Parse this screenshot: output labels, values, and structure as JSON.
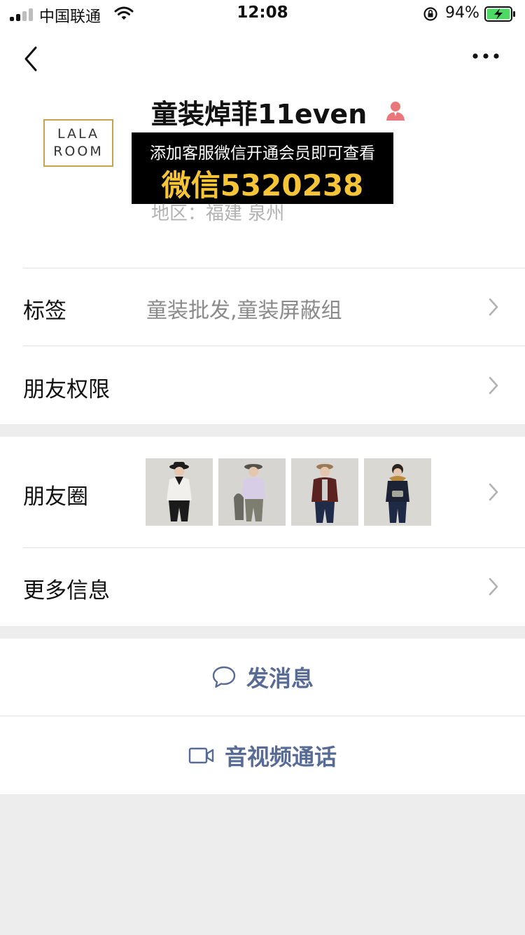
{
  "status_bar": {
    "carrier": "中国联通",
    "time": "12:08",
    "battery_percent": "94%"
  },
  "profile": {
    "logo_line1": "LALA",
    "logo_line2": "ROOM",
    "name": "童装焯菲11even",
    "promo_line1": "添加客服微信开通会员即可查看",
    "promo_line2": "微信5320238",
    "region": "地区：福建 泉州"
  },
  "cells": {
    "tags": {
      "label": "标签",
      "value": "童装批发,童装屏蔽组"
    },
    "permissions": {
      "label": "朋友权限"
    },
    "moments": {
      "label": "朋友圈"
    },
    "more_info": {
      "label": "更多信息"
    }
  },
  "actions": {
    "message": "发消息",
    "call": "音视频通话"
  },
  "icons": {
    "back": "chevron-left-icon",
    "more": "ellipsis-icon",
    "person": "person-icon",
    "chevron": "chevron-right-icon",
    "message": "chat-bubble-icon",
    "video": "video-camera-icon"
  },
  "colors": {
    "link_blue": "#576b95",
    "promo_yellow": "#f6c437",
    "battery_green": "#4cd964",
    "person_red": "#e8767a",
    "logo_gold": "#c9a54a"
  }
}
